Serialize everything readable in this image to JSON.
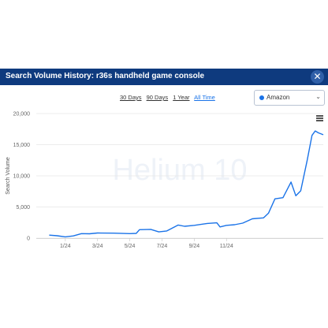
{
  "header": {
    "title": "Search Volume History: r36s handheld game console",
    "close_icon": "close-icon"
  },
  "range_options": [
    "30 Days",
    "90 Days",
    "1 Year",
    "All Time"
  ],
  "active_range": "All Time",
  "marketplace": {
    "selected": "Amazon"
  },
  "watermark": "Helium 10",
  "colors": {
    "header": "#0e3a7e",
    "line": "#1a73e8",
    "accent": "#1a73e8"
  },
  "chart_data": {
    "type": "line",
    "title": "",
    "xlabel": "",
    "ylabel": "Search Volume",
    "ylim": [
      0,
      20000
    ],
    "y_ticks": [
      "0",
      "5,000",
      "10,000",
      "15,000",
      "20,000"
    ],
    "x_ticks": [
      "1/24",
      "3/24",
      "5/24",
      "7/24",
      "9/24",
      "11/24"
    ],
    "grid": true,
    "legend": "none",
    "series": [
      {
        "points": [
          [
            0,
            480
          ],
          [
            0.5,
            380
          ],
          [
            1,
            200
          ],
          [
            1.5,
            350
          ],
          [
            2,
            720
          ],
          [
            2.5,
            700
          ],
          [
            3,
            820
          ],
          [
            4,
            800
          ],
          [
            5,
            720
          ],
          [
            5.4,
            760
          ],
          [
            5.6,
            1350
          ],
          [
            6.3,
            1400
          ],
          [
            6.8,
            1000
          ],
          [
            7.3,
            1150
          ],
          [
            8,
            2100
          ],
          [
            8.4,
            1900
          ],
          [
            9,
            2050
          ],
          [
            9.8,
            2350
          ],
          [
            10.4,
            2450
          ],
          [
            10.6,
            1800
          ],
          [
            11,
            2050
          ],
          [
            11.5,
            2150
          ],
          [
            12,
            2400
          ],
          [
            12.6,
            3100
          ],
          [
            13.3,
            3250
          ],
          [
            13.6,
            4000
          ],
          [
            14,
            6300
          ],
          [
            14.5,
            6500
          ],
          [
            15,
            9000
          ],
          [
            15.3,
            6800
          ],
          [
            15.6,
            7600
          ],
          [
            16,
            12500
          ],
          [
            16.3,
            16500
          ],
          [
            16.5,
            17200
          ],
          [
            16.7,
            16900
          ],
          [
            17,
            16600
          ]
        ]
      }
    ],
    "x_tick_positions": [
      1,
      3,
      5,
      7,
      9,
      11
    ],
    "xlim": [
      -0.8,
      17
    ]
  }
}
